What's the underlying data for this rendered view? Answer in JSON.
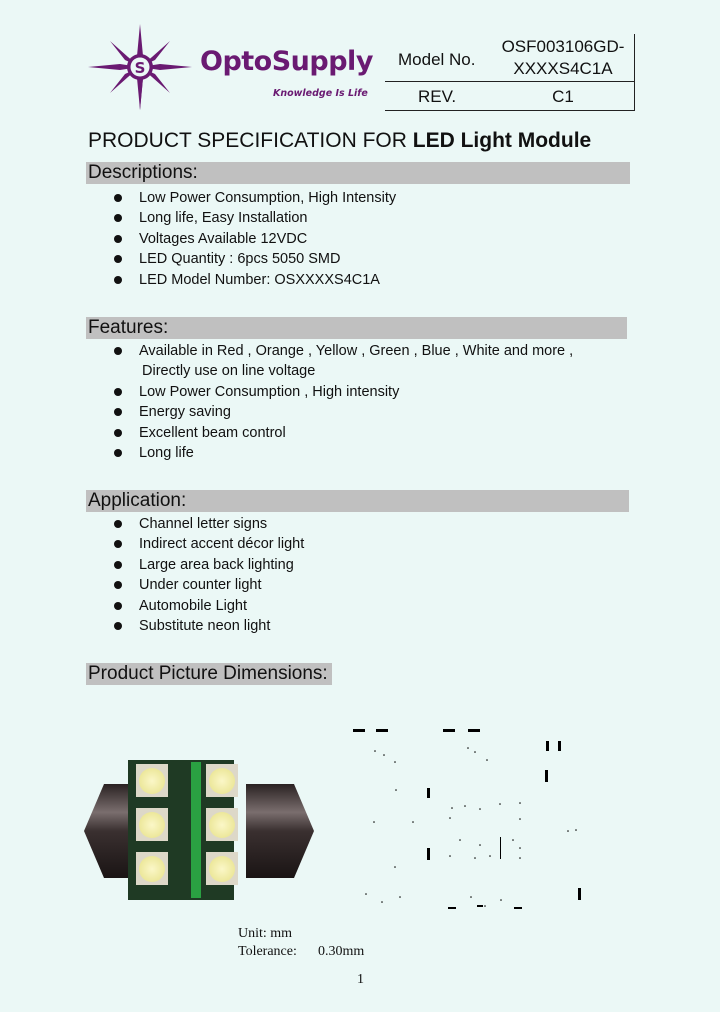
{
  "logo": {
    "brand": "OptoSupply",
    "tagline": "Knowledge Is Life",
    "brand_color": "#6a1a72"
  },
  "header_table": {
    "model_label": "Model No.",
    "model_value_line1": "OSF003106GD-",
    "model_value_line2": "XXXXS4C1A",
    "rev_label": "REV.",
    "rev_value": "C1"
  },
  "title": {
    "prefix": "PRODUCT SPECIFICATION FOR ",
    "bold": "LED Light  Module"
  },
  "sections": {
    "descriptions": {
      "heading": "Descriptions:",
      "items": [
        "Low Power Consumption, High Intensity",
        "Long life, Easy Installation",
        "Voltages Available 12VDC",
        "LED Quantity : 6pcs 5050 SMD",
        "LED Model Number: OSXXXXS4C1A"
      ]
    },
    "features": {
      "heading": "Features:",
      "items": [
        "Available in Red , Orange , Yellow , Green , Blue , White and more ,",
        "Low Power Consumption , High intensity",
        "Energy saving",
        "Excellent beam control",
        "Long life"
      ],
      "continuation": "Directly use on line voltage"
    },
    "application": {
      "heading": "Application:",
      "items": [
        "Channel letter signs",
        "Indirect accent décor light",
        "Large area back lighting",
        "Under counter light",
        "Automobile Light",
        "Substitute neon light"
      ]
    },
    "dimensions": {
      "heading": "Product Picture Dimensions:"
    }
  },
  "notes": {
    "unit": "Unit: mm",
    "tolerance_label": "Tolerance:",
    "tolerance_value": "0.30mm"
  },
  "page_number": "1"
}
